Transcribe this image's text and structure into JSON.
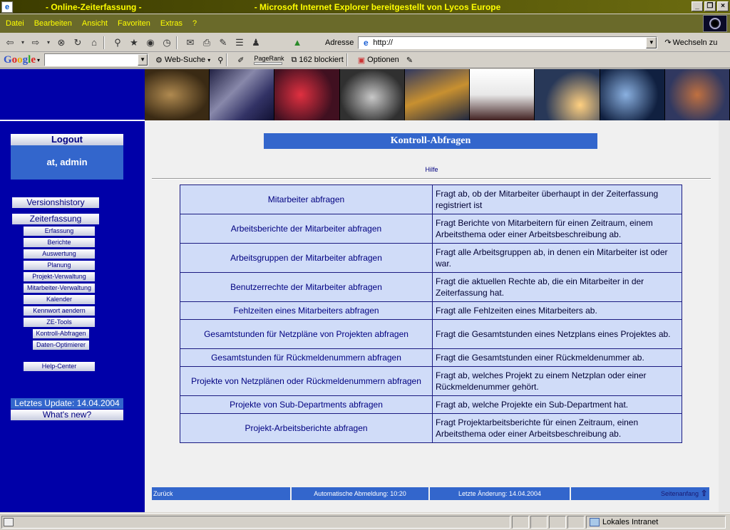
{
  "window": {
    "title_left": "- Online-Zeiterfassung -",
    "title_right": "- Microsoft Internet Explorer bereitgestellt von Lycos Europe"
  },
  "menu": [
    "Datei",
    "Bearbeiten",
    "Ansicht",
    "Favoriten",
    "Extras",
    "?"
  ],
  "address": {
    "label": "Adresse",
    "value": "http://",
    "go": "Wechseln zu"
  },
  "google_bar": {
    "web_search": "Web-Suche",
    "pagerank": "PageRank",
    "blocked": "162 blockiert",
    "options": "Optionen"
  },
  "sidebar": {
    "logout": "Logout",
    "user": "at, admin",
    "versionshistory": "Versionshistory",
    "zeiterfassung": "Zeiterfassung",
    "sub_items": [
      "Erfassung",
      "Berichte",
      "Auswertung",
      "Planung",
      "Projekt-Verwaltung",
      "Mitarbeiter-Verwaltung",
      "Kalender",
      "Kennwort aendern",
      "ZE-Tools"
    ],
    "ze_tools_sub": [
      "Kontroll-Abfragen",
      "Daten-Optimierer"
    ],
    "help_center": "Help-Center",
    "last_update": "Letztes Update: 14.04.2004",
    "whats_new": "What's new?"
  },
  "main": {
    "title": "Kontroll-Abfragen",
    "hilfe": "Hilfe",
    "rows": [
      {
        "query": "Mitarbeiter abfragen",
        "desc": "Fragt ab, ob der Mitarbeiter überhaupt in der Zeiterfassung registriert ist"
      },
      {
        "query": "Arbeitsberichte der Mitarbeiter abfragen",
        "desc": "Fragt Berichte von Mitarbeitern für einen Zeitraum, einem Arbeitsthema oder einer Arbeitsbeschreibung ab."
      },
      {
        "query": "Arbeitsgruppen der Mitarbeiter abfragen",
        "desc": "Fragt alle Arbeitsgruppen ab, in denen ein Mitarbeiter ist oder war."
      },
      {
        "query": "Benutzerrechte der Mitarbeiter abfragen",
        "desc": "Fragt die aktuellen Rechte ab, die ein Mitarbeiter in der Zeiterfassung hat."
      },
      {
        "query": "Fehlzeiten eines Mitarbeiters abfragen",
        "desc": "Fragt alle Fehlzeiten eines Mitarbeiters ab."
      },
      {
        "query": "Gesamtstunden für Netzpläne von Projekten abfragen",
        "desc": "Fragt die Gesamtstunden eines Netzplans eines Projektes ab."
      },
      {
        "query": "Gesamtstunden für Rückmeldenummern abfragen",
        "desc": "Fragt die Gesamtstunden einer Rückmeldenummer ab."
      },
      {
        "query": "Projekte von Netzplänen oder Rückmeldenummern abfragen",
        "desc": "Fragt ab, welches Projekt zu einem Netzplan oder einer Rückmeldenummer gehört."
      },
      {
        "query": "Projekte von Sub-Departments abfragen",
        "desc": "Fragt ab, welche Projekte ein Sub-Department hat."
      },
      {
        "query": "Projekt-Arbeitsberichte abfragen",
        "desc": "Fragt Projektarbeitsberichte für einen Zeitraum, einen Arbeitsthema oder einer Arbeitsbeschreibung ab."
      }
    ],
    "footer": {
      "back": "Zurück",
      "auto_logout": "Automatische Abmeldung: 10:20",
      "last_change": "Letzte Änderung: 14.04.2004",
      "top": "Seitenanfang"
    }
  },
  "status": {
    "zone": "Lokales Intranet"
  },
  "colors": {
    "sidebar_bg": "#0000a8",
    "accent_blue": "#3366cc",
    "cell_bg": "#d0dcf8",
    "title_text": "#ffff00"
  }
}
